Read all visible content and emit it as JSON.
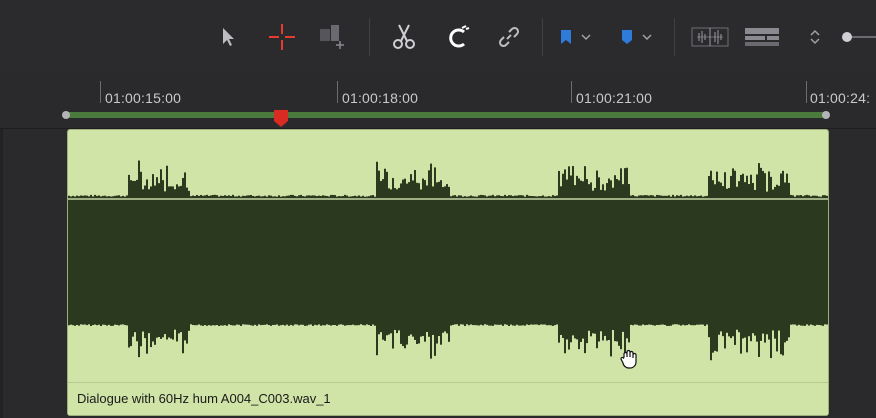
{
  "toolbar": {
    "tools": [
      {
        "name": "selection-tool",
        "icon": "arrow-pointer-icon"
      },
      {
        "name": "blade-tool",
        "icon": "crosshair-icon",
        "color": "#e63b2e"
      },
      {
        "name": "trim-tool",
        "icon": "trim-icon"
      },
      {
        "name": "razor-tool",
        "icon": "scissors-icon"
      },
      {
        "name": "snapping-toggle",
        "icon": "magnet-icon"
      },
      {
        "name": "linked-selection-toggle",
        "icon": "link-icon"
      },
      {
        "name": "flag-dropdown",
        "icon": "flag-icon",
        "color": "#2f7bd9"
      },
      {
        "name": "marker-dropdown",
        "icon": "marker-icon",
        "color": "#2f7bd9"
      },
      {
        "name": "audio-waveform-view",
        "icon": "waveform-view-icon"
      },
      {
        "name": "track-height",
        "icon": "track-height-icon"
      },
      {
        "name": "zoom-stepper",
        "icon": "up-down-icon"
      },
      {
        "name": "zoom-slider",
        "icon": "slider-knob-icon"
      }
    ]
  },
  "ruler": {
    "timecodes": [
      "01:00:15:00",
      "01:00:18:00",
      "01:00:21:00",
      "01:00:24:"
    ]
  },
  "clip": {
    "label": "Dialogue with 60Hz hum A004_C003.wav_1",
    "color": "#cfe4a6",
    "waveform_color": "#2b3a1f"
  },
  "playhead": {
    "color": "#d92b22"
  },
  "range": {
    "color": "#4a7a3c"
  }
}
